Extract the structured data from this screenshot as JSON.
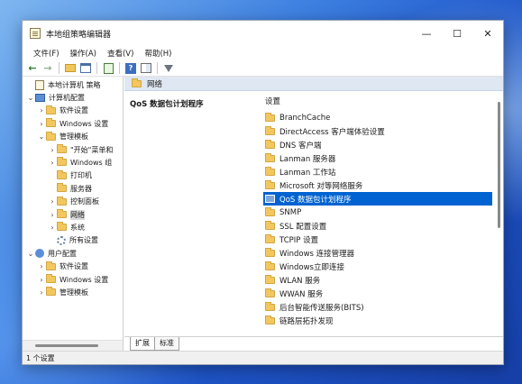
{
  "window": {
    "title": "本地组策略编辑器",
    "controls": {
      "minimize": "—",
      "maximize": "☐",
      "close": "✕"
    }
  },
  "menu": [
    "文件(F)",
    "操作(A)",
    "查看(V)",
    "帮助(H)"
  ],
  "toolbar": {
    "buttons": [
      "back-icon",
      "forward-icon",
      "folder-up-icon",
      "show-hide-tree-icon",
      "export-list-icon",
      "help-icon",
      "properties-icon",
      "filter-icon"
    ]
  },
  "tree": [
    {
      "label": "本地计算机 策略",
      "level": 0,
      "twisty": "",
      "icon": "policy-icon"
    },
    {
      "label": "计算机配置",
      "level": 0,
      "twisty": "⌄",
      "icon": "computer-icon"
    },
    {
      "label": "软件设置",
      "level": 1,
      "twisty": "›",
      "icon": "folder-icon"
    },
    {
      "label": "Windows 设置",
      "level": 1,
      "twisty": "›",
      "icon": "folder-icon"
    },
    {
      "label": "管理模板",
      "level": 1,
      "twisty": "⌄",
      "icon": "folder-icon"
    },
    {
      "label": "\"开始\"菜单和",
      "level": 2,
      "twisty": "›",
      "icon": "folder-icon"
    },
    {
      "label": "Windows 组",
      "level": 2,
      "twisty": "›",
      "icon": "folder-icon"
    },
    {
      "label": "打印机",
      "level": 2,
      "twisty": "",
      "icon": "folder-icon"
    },
    {
      "label": "服务器",
      "level": 2,
      "twisty": "",
      "icon": "folder-icon"
    },
    {
      "label": "控制面板",
      "level": 2,
      "twisty": "›",
      "icon": "folder-icon"
    },
    {
      "label": "网络",
      "level": 2,
      "twisty": "›",
      "icon": "folder-icon",
      "selected": true
    },
    {
      "label": "系统",
      "level": 2,
      "twisty": "›",
      "icon": "folder-icon"
    },
    {
      "label": "所有设置",
      "level": 2,
      "twisty": "",
      "icon": "settings-icon"
    },
    {
      "label": "用户配置",
      "level": 0,
      "twisty": "⌄",
      "icon": "user-icon"
    },
    {
      "label": "软件设置",
      "level": 1,
      "twisty": "›",
      "icon": "folder-icon"
    },
    {
      "label": "Windows 设置",
      "level": 1,
      "twisty": "›",
      "icon": "folder-icon"
    },
    {
      "label": "管理模板",
      "level": 1,
      "twisty": "›",
      "icon": "folder-icon"
    }
  ],
  "detail": {
    "header": "网络",
    "description_title": "QoS 数据包计划程序",
    "list_header": "设置",
    "items": [
      {
        "label": "BranchCache",
        "icon": "folder-icon"
      },
      {
        "label": "DirectAccess 客户端体验设置",
        "icon": "folder-icon"
      },
      {
        "label": "DNS 客户端",
        "icon": "folder-icon"
      },
      {
        "label": "Lanman 服务器",
        "icon": "folder-icon"
      },
      {
        "label": "Lanman 工作站",
        "icon": "folder-icon"
      },
      {
        "label": "Microsoft 对等网络服务",
        "icon": "folder-icon"
      },
      {
        "label": "QoS 数据包计划程序",
        "icon": "qos-icon",
        "selected": true
      },
      {
        "label": "SNMP",
        "icon": "folder-icon"
      },
      {
        "label": "SSL 配置设置",
        "icon": "folder-icon"
      },
      {
        "label": "TCPIP 设置",
        "icon": "folder-icon"
      },
      {
        "label": "Windows 连接管理器",
        "icon": "folder-icon"
      },
      {
        "label": "Windows立即连接",
        "icon": "folder-icon"
      },
      {
        "label": "WLAN 服务",
        "icon": "folder-icon"
      },
      {
        "label": "WWAN 服务",
        "icon": "folder-icon"
      },
      {
        "label": "后台智能传送服务(BITS)",
        "icon": "folder-icon"
      },
      {
        "label": "链路层拓扑发现",
        "icon": "folder-icon"
      }
    ]
  },
  "tabs": [
    "扩展",
    "标准"
  ],
  "status": "1 个设置"
}
